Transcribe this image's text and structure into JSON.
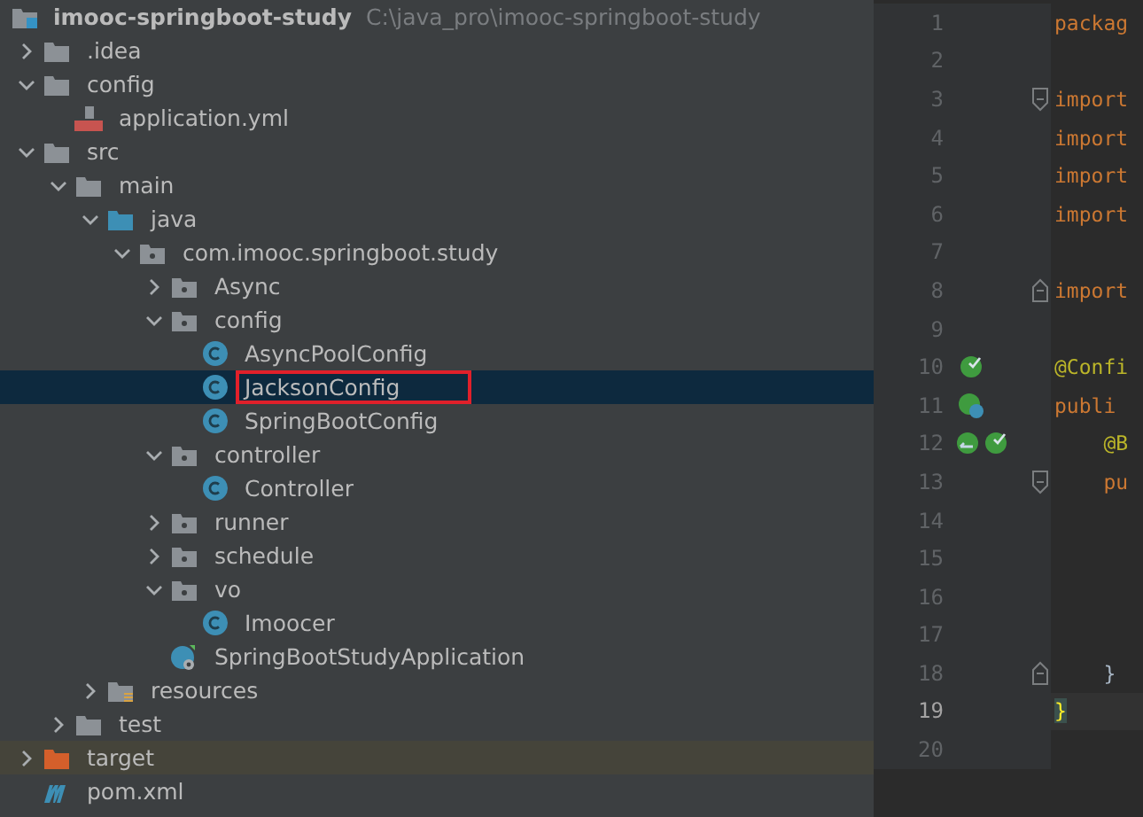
{
  "project": {
    "name": "imooc-springboot-study",
    "path": "C:\\java_pro\\imooc-springboot-study"
  },
  "tree": [
    {
      "name": ".idea",
      "kind": "folder",
      "expanded": false,
      "selected": false,
      "outlined": false
    },
    {
      "name": "config",
      "kind": "folder",
      "expanded": true,
      "selected": false,
      "outlined": false,
      "children": [
        {
          "name": "application.yml",
          "kind": "yml",
          "selected": false,
          "outlined": false
        }
      ]
    },
    {
      "name": "src",
      "kind": "folder",
      "expanded": true,
      "selected": false,
      "outlined": false,
      "children": [
        {
          "name": "main",
          "kind": "folder",
          "expanded": true,
          "selected": false,
          "outlined": false,
          "children": [
            {
              "name": "java",
              "kind": "source",
              "expanded": true,
              "selected": false,
              "outlined": false,
              "children": [
                {
                  "name": "com.imooc.springboot.study",
                  "kind": "package",
                  "expanded": true,
                  "selected": false,
                  "outlined": false,
                  "children": [
                    {
                      "name": "Async",
                      "kind": "package",
                      "expanded": false,
                      "selected": false,
                      "outlined": false
                    },
                    {
                      "name": "config",
                      "kind": "package",
                      "expanded": true,
                      "selected": false,
                      "outlined": false,
                      "children": [
                        {
                          "name": "AsyncPoolConfig",
                          "kind": "class",
                          "selected": false,
                          "outlined": false
                        },
                        {
                          "name": "JacksonConfig",
                          "kind": "class",
                          "selected": true,
                          "outlined": true
                        },
                        {
                          "name": "SpringBootConfig",
                          "kind": "class",
                          "selected": false,
                          "outlined": false
                        }
                      ]
                    },
                    {
                      "name": "controller",
                      "kind": "package",
                      "expanded": true,
                      "selected": false,
                      "outlined": false,
                      "children": [
                        {
                          "name": "Controller",
                          "kind": "class",
                          "selected": false,
                          "outlined": false
                        }
                      ]
                    },
                    {
                      "name": "runner",
                      "kind": "package",
                      "expanded": false,
                      "selected": false,
                      "outlined": false
                    },
                    {
                      "name": "schedule",
                      "kind": "package",
                      "expanded": false,
                      "selected": false,
                      "outlined": false
                    },
                    {
                      "name": "vo",
                      "kind": "package",
                      "expanded": true,
                      "selected": false,
                      "outlined": false,
                      "children": [
                        {
                          "name": "Imoocer",
                          "kind": "class",
                          "selected": false,
                          "outlined": false
                        }
                      ]
                    },
                    {
                      "name": "SpringBootStudyApplication",
                      "kind": "app",
                      "selected": false,
                      "outlined": false
                    }
                  ]
                }
              ]
            },
            {
              "name": "resources",
              "kind": "resources",
              "expanded": false,
              "selected": false,
              "outlined": false
            }
          ]
        },
        {
          "name": "test",
          "kind": "folder",
          "expanded": false,
          "selected": false,
          "outlined": false
        }
      ]
    },
    {
      "name": "target",
      "kind": "excluded",
      "expanded": false,
      "selected": false,
      "outlined": false
    },
    {
      "name": "pom.xml",
      "kind": "maven",
      "selected": false,
      "outlined": false
    }
  ],
  "editor": {
    "lines": [
      {
        "number": "1",
        "kind": "plain",
        "fold_start": false,
        "fold_end": false,
        "current": false,
        "code": {
          "kind": "keyword",
          "text": "packag"
        }
      },
      {
        "number": "2",
        "kind": "plain",
        "fold_start": false,
        "fold_end": false,
        "current": false
      },
      {
        "number": "3",
        "kind": "plain",
        "fold_start": true,
        "fold_end": false,
        "current": false,
        "code": {
          "kind": "keyword",
          "text": "import"
        }
      },
      {
        "number": "4",
        "kind": "plain",
        "fold_start": false,
        "fold_end": false,
        "current": false,
        "code": {
          "kind": "keyword",
          "text": "import"
        }
      },
      {
        "number": "5",
        "kind": "plain",
        "fold_start": false,
        "fold_end": false,
        "current": false,
        "code": {
          "kind": "keyword",
          "text": "import"
        }
      },
      {
        "number": "6",
        "kind": "plain",
        "fold_start": false,
        "fold_end": false,
        "current": false,
        "code": {
          "kind": "keyword",
          "text": "import"
        }
      },
      {
        "number": "7",
        "kind": "plain",
        "fold_start": false,
        "fold_end": false,
        "current": false
      },
      {
        "number": "8",
        "kind": "plain",
        "fold_start": false,
        "fold_end": true,
        "current": false,
        "code": {
          "kind": "keyword",
          "text": "import"
        }
      },
      {
        "number": "9",
        "kind": "plain",
        "fold_start": false,
        "fold_end": false,
        "current": false
      },
      {
        "number": "10",
        "kind": "bean",
        "fold_start": false,
        "fold_end": false,
        "current": false,
        "code": {
          "kind": "annotation",
          "text": "@Confi"
        }
      },
      {
        "number": "11",
        "kind": "bean-web",
        "fold_start": false,
        "fold_end": false,
        "current": false,
        "code": {
          "kind": "keyword",
          "text": "publi"
        }
      },
      {
        "number": "12",
        "kind": "bean-pair",
        "fold_start": false,
        "fold_end": false,
        "current": false,
        "code": {
          "kind": "annotation",
          "text": "    @B"
        }
      },
      {
        "number": "13",
        "kind": "plain",
        "fold_start": true,
        "fold_end": false,
        "current": false,
        "code": {
          "kind": "keyword",
          "text": "    pu"
        }
      },
      {
        "number": "14",
        "kind": "plain",
        "fold_start": false,
        "fold_end": false,
        "current": false
      },
      {
        "number": "15",
        "kind": "plain",
        "fold_start": false,
        "fold_end": false,
        "current": false
      },
      {
        "number": "16",
        "kind": "plain",
        "fold_start": false,
        "fold_end": false,
        "current": false
      },
      {
        "number": "17",
        "kind": "plain",
        "fold_start": false,
        "fold_end": false,
        "current": false
      },
      {
        "number": "18",
        "kind": "plain",
        "fold_start": false,
        "fold_end": true,
        "current": false,
        "code": {
          "kind": "plain",
          "text": "    }"
        }
      },
      {
        "number": "19",
        "kind": "plain",
        "fold_start": false,
        "fold_end": false,
        "current": true,
        "code": {
          "kind": "brace",
          "text": "}"
        }
      },
      {
        "number": "20",
        "kind": "plain",
        "fold_start": false,
        "fold_end": false,
        "current": false
      }
    ]
  }
}
